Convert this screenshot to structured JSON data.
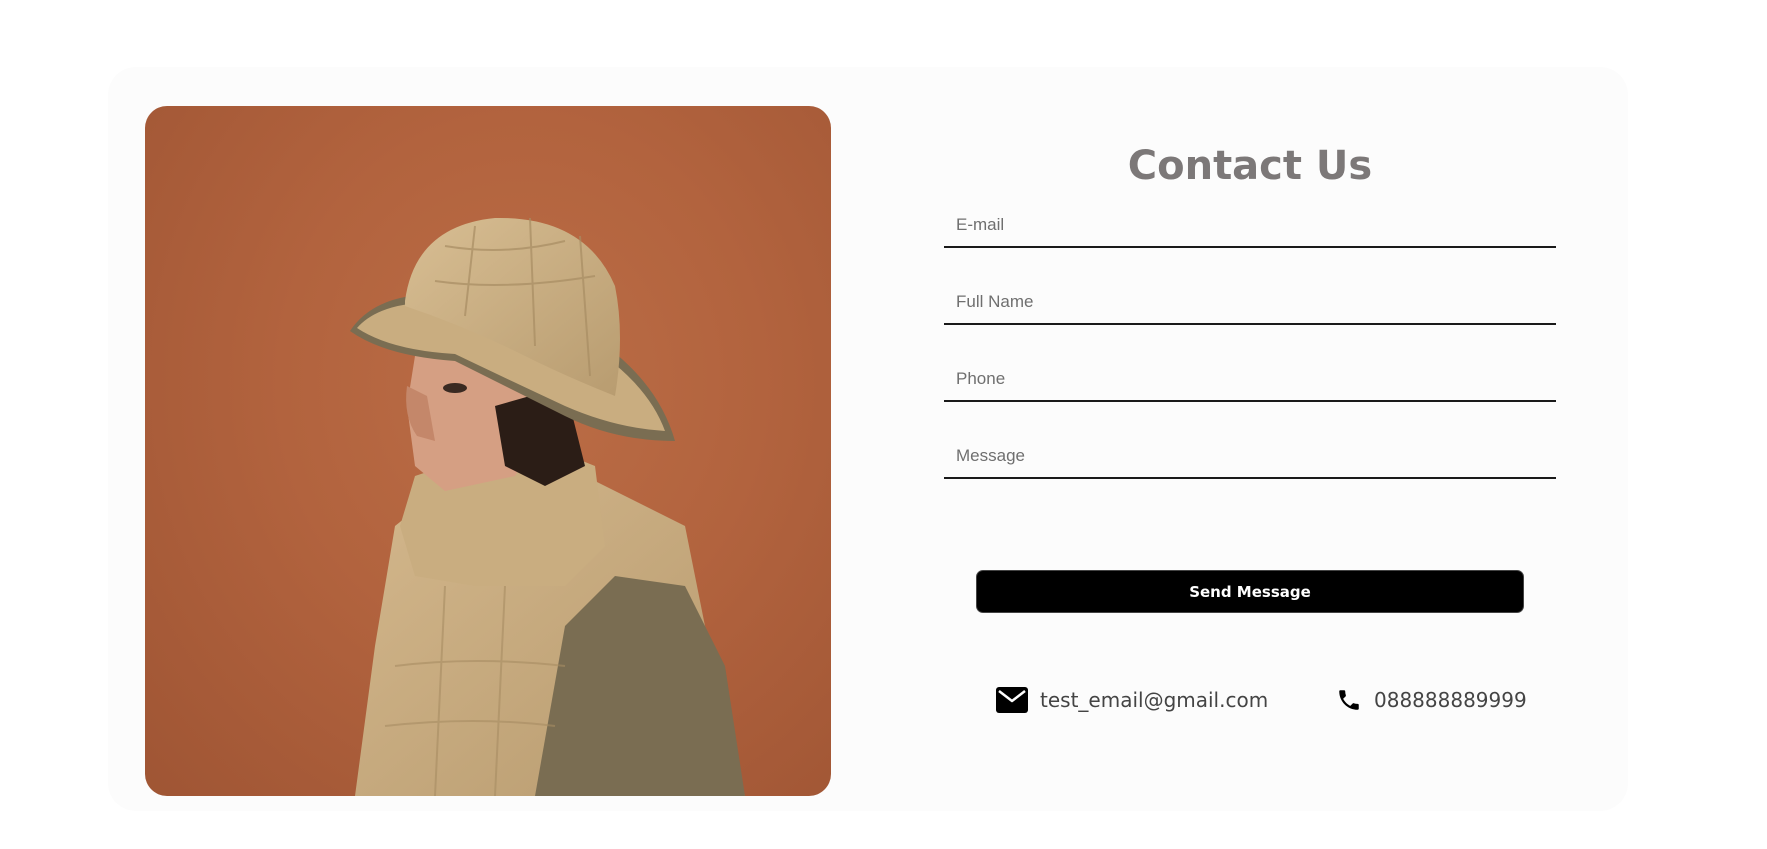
{
  "contact": {
    "title": "Contact Us",
    "fields": {
      "email_placeholder": "E-mail",
      "name_placeholder": "Full Name",
      "phone_placeholder": "Phone",
      "message_placeholder": "Message"
    },
    "send_label": "Send Message",
    "email_text": "test_email@gmail.com",
    "phone_text": "088888889999"
  },
  "icons": {
    "email": "envelope-icon",
    "phone": "phone-icon"
  },
  "colors": {
    "button_bg": "#000000",
    "title": "#7c7878",
    "photo_background": "#b2633e"
  }
}
